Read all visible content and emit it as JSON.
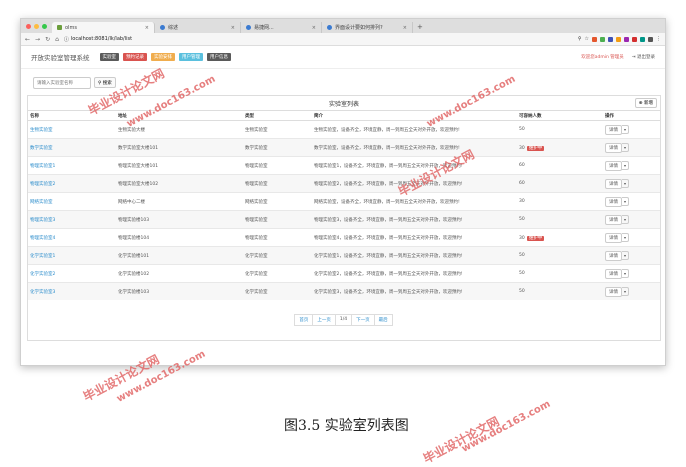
{
  "browser": {
    "tabs": [
      {
        "label": "olms"
      },
      {
        "label": "综述"
      },
      {
        "label": "易捷网..."
      },
      {
        "label": "界面设计要如何排列?"
      }
    ],
    "new_tab": "+",
    "url": "localhost:8081/lk/lab/list"
  },
  "app": {
    "title": "开放实验室管理系统",
    "menu": [
      {
        "label": "实验室",
        "color": "#5a5a5a"
      },
      {
        "label": "预约记录",
        "color": "#d9534f"
      },
      {
        "label": "实验安排",
        "color": "#f0ad4e"
      },
      {
        "label": "用户管理",
        "color": "#5bc0de"
      },
      {
        "label": "用户信息",
        "color": "#5a5a5a"
      }
    ],
    "user": "欢迎您admin 管理员",
    "logout": "退出登录"
  },
  "search": {
    "placeholder": "请输入实验室名称",
    "button": "搜索"
  },
  "panel": {
    "title": "实验室列表",
    "add_button": "新增",
    "columns": [
      "名称",
      "地址",
      "类型",
      "简介",
      "可容纳人数",
      "操作"
    ],
    "rows": [
      {
        "name": "生物实验室",
        "addr": "生物实验大楼",
        "type": "生物实验室",
        "desc": "生物实验室，设备齐全，环境宜静，周一到周五全天对外开放，欢迎预约!",
        "cap": "50",
        "badge": ""
      },
      {
        "name": "数学实验室",
        "addr": "数学实验室大楼101",
        "type": "数学实验室",
        "desc": "数学实验室，设备齐全，环境宜静，周一到周五全天对外开放，欢迎预约!",
        "cap": "30",
        "badge": "维护中"
      },
      {
        "name": "物理实验室1",
        "addr": "物理实验室大楼101",
        "type": "物理实验室",
        "desc": "物理实验室1，设备齐全，环境宜静，周一到周五全天对外开放，欢迎预约!",
        "cap": "60",
        "badge": ""
      },
      {
        "name": "物理实验室2",
        "addr": "物理实验室大楼102",
        "type": "物理实验室",
        "desc": "物理实验室2，设备齐全，环境宜静，周一到周五全天对外开放，欢迎预约!",
        "cap": "60",
        "badge": ""
      },
      {
        "name": "网络实验室",
        "addr": "网络中心二楼",
        "type": "网络实验室",
        "desc": "网络实验室，设备齐全，环境宜静，周一到周五全天对外开放，欢迎预约!",
        "cap": "30",
        "badge": ""
      },
      {
        "name": "物理实验室3",
        "addr": "物理实验楼103",
        "type": "物理实验室",
        "desc": "物理实验室3，设备齐全，环境宜静，周一到周五全天对外开放，欢迎预约!",
        "cap": "50",
        "badge": ""
      },
      {
        "name": "物理实验室4",
        "addr": "物理实验楼104",
        "type": "物理实验室",
        "desc": "物理实验室4，设备齐全，环境宜静，周一到周五全天对外开放，欢迎预约!",
        "cap": "30",
        "badge": "维护中"
      },
      {
        "name": "化学实验室1",
        "addr": "化学实验楼101",
        "type": "化学实验室",
        "desc": "化学实验室1，设备齐全，环境宜静，周一到周五全天对外开放，欢迎预约!",
        "cap": "50",
        "badge": ""
      },
      {
        "name": "化学实验室2",
        "addr": "化学实验楼102",
        "type": "化学实验室",
        "desc": "化学实验室2，设备齐全，环境宜静，周一到周五全天对外开放，欢迎预约!",
        "cap": "50",
        "badge": ""
      },
      {
        "name": "化学实验室3",
        "addr": "化学实验楼103",
        "type": "化学实验室",
        "desc": "化学实验室3，设备齐全，环境宜静，周一到周五全天对外开放，欢迎预约!",
        "cap": "50",
        "badge": ""
      }
    ],
    "detail_button": "详情",
    "pager": [
      "首页",
      "上一页",
      "1/4",
      "下一页",
      "最后"
    ]
  },
  "caption": "图3.5  实验室列表图",
  "watermark": {
    "cn": "毕业设计论文网",
    "url": "www.doc163.com"
  }
}
